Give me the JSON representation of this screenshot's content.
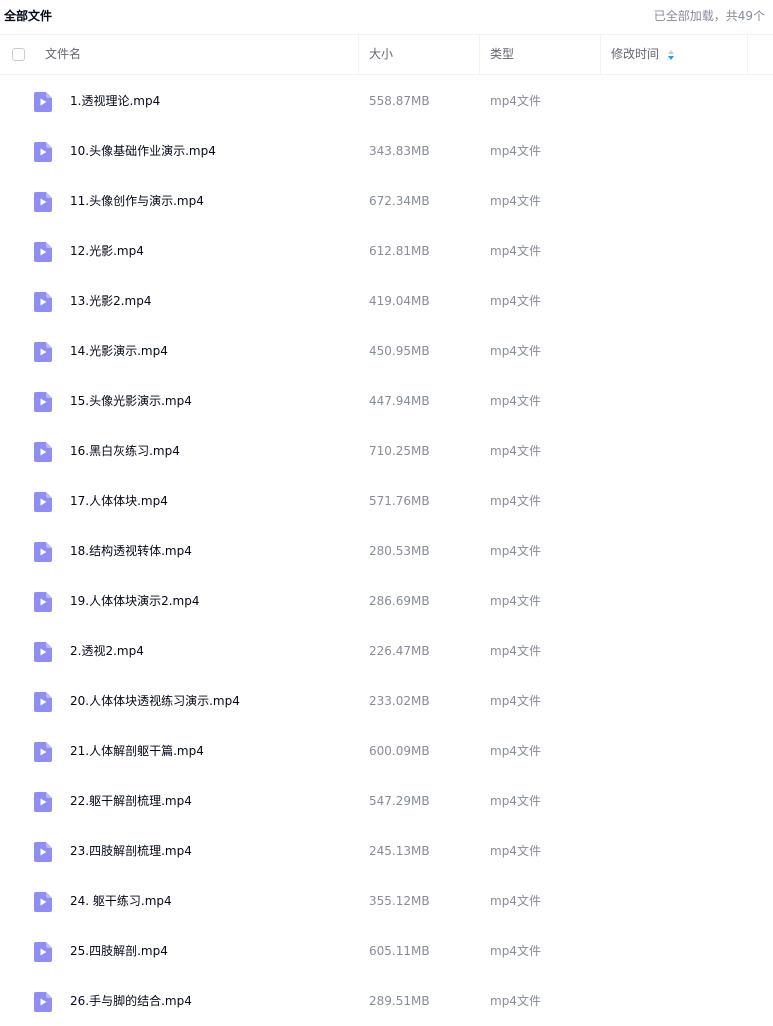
{
  "topbar": {
    "title": "全部文件",
    "status": "已全部加载，共49个"
  },
  "header": {
    "name": "文件名",
    "size": "大小",
    "type": "类型",
    "modified": "修改时间"
  },
  "colors": {
    "accent": "#06a7ff",
    "file_icon": "#8f8ef5"
  },
  "files": [
    {
      "name": "1.透视理论.mp4",
      "size": "558.87MB",
      "type": "mp4文件",
      "icon": "video-file-icon"
    },
    {
      "name": "10.头像基础作业演示.mp4",
      "size": "343.83MB",
      "type": "mp4文件",
      "icon": "video-file-icon"
    },
    {
      "name": "11.头像创作与演示.mp4",
      "size": "672.34MB",
      "type": "mp4文件",
      "icon": "video-file-icon"
    },
    {
      "name": "12.光影.mp4",
      "size": "612.81MB",
      "type": "mp4文件",
      "icon": "video-file-icon"
    },
    {
      "name": "13.光影2.mp4",
      "size": "419.04MB",
      "type": "mp4文件",
      "icon": "video-file-icon"
    },
    {
      "name": "14.光影演示.mp4",
      "size": "450.95MB",
      "type": "mp4文件",
      "icon": "video-file-icon"
    },
    {
      "name": "15.头像光影演示.mp4",
      "size": "447.94MB",
      "type": "mp4文件",
      "icon": "video-file-icon"
    },
    {
      "name": "16.黑白灰练习.mp4",
      "size": "710.25MB",
      "type": "mp4文件",
      "icon": "video-file-icon"
    },
    {
      "name": "17.人体体块.mp4",
      "size": "571.76MB",
      "type": "mp4文件",
      "icon": "video-file-icon"
    },
    {
      "name": "18.结构透视转体.mp4",
      "size": "280.53MB",
      "type": "mp4文件",
      "icon": "video-file-icon"
    },
    {
      "name": "19.人体体块演示2.mp4",
      "size": "286.69MB",
      "type": "mp4文件",
      "icon": "video-file-icon"
    },
    {
      "name": "2.透视2.mp4",
      "size": "226.47MB",
      "type": "mp4文件",
      "icon": "video-file-icon"
    },
    {
      "name": "20.人体体块透视练习演示.mp4",
      "size": "233.02MB",
      "type": "mp4文件",
      "icon": "video-file-icon"
    },
    {
      "name": "21.人体解剖躯干篇.mp4",
      "size": "600.09MB",
      "type": "mp4文件",
      "icon": "video-file-icon"
    },
    {
      "name": "22.躯干解剖梳理.mp4",
      "size": "547.29MB",
      "type": "mp4文件",
      "icon": "video-file-icon"
    },
    {
      "name": "23.四肢解剖梳理.mp4",
      "size": "245.13MB",
      "type": "mp4文件",
      "icon": "video-file-icon"
    },
    {
      "name": "24. 躯干练习.mp4",
      "size": "355.12MB",
      "type": "mp4文件",
      "icon": "video-file-icon"
    },
    {
      "name": "25.四肢解剖.mp4",
      "size": "605.11MB",
      "type": "mp4文件",
      "icon": "video-file-icon"
    },
    {
      "name": "26.手与脚的结合.mp4",
      "size": "289.51MB",
      "type": "mp4文件",
      "icon": "video-file-icon"
    }
  ]
}
